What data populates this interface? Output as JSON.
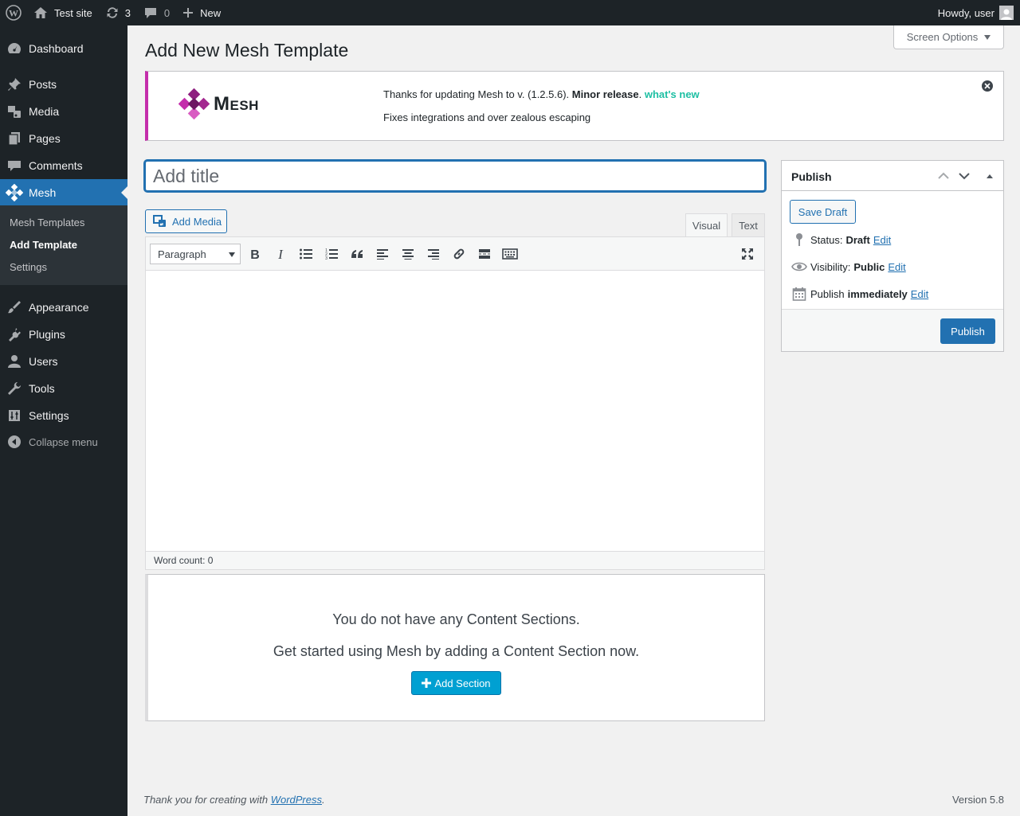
{
  "adminbar": {
    "site_name": "Test site",
    "updates_count": "3",
    "comments_count": "0",
    "new_label": "New",
    "howdy": "Howdy, user"
  },
  "sidebar": {
    "items": [
      {
        "label": "Dashboard",
        "icon": "dashboard-icon"
      },
      {
        "label": "Posts",
        "icon": "pin-icon"
      },
      {
        "label": "Media",
        "icon": "media-icon"
      },
      {
        "label": "Pages",
        "icon": "pages-icon"
      },
      {
        "label": "Comments",
        "icon": "comment-icon"
      },
      {
        "label": "Mesh",
        "icon": "mesh-icon"
      },
      {
        "label": "Appearance",
        "icon": "brush-icon"
      },
      {
        "label": "Plugins",
        "icon": "plugin-icon"
      },
      {
        "label": "Users",
        "icon": "user-icon"
      },
      {
        "label": "Tools",
        "icon": "wrench-icon"
      },
      {
        "label": "Settings",
        "icon": "settings-icon"
      }
    ],
    "submenu": [
      "Mesh Templates",
      "Add Template",
      "Settings"
    ],
    "collapse_label": "Collapse menu"
  },
  "page": {
    "title": "Add New Mesh Template",
    "screen_options": "Screen Options"
  },
  "notice": {
    "logo_text": "Mesh",
    "line1_prefix": "Thanks for updating Mesh to v. (1.2.5.6). ",
    "line1_bold": "Minor release",
    "line1_sep": ". ",
    "line1_link": "what's new",
    "line2": "Fixes integrations and over zealous escaping"
  },
  "editor": {
    "title_placeholder": "Add title",
    "add_media": "Add Media",
    "tab_visual": "Visual",
    "tab_text": "Text",
    "format_value": "Paragraph",
    "word_count": "Word count: 0"
  },
  "mesh": {
    "message1": "You do not have any Content Sections.",
    "message2": "Get started using Mesh by adding a Content Section now.",
    "add_section": "Add Section"
  },
  "publish": {
    "title": "Publish",
    "save_draft": "Save Draft",
    "status_label": "Status:",
    "status_value": "Draft",
    "visibility_label": "Visibility:",
    "visibility_value": "Public",
    "schedule_label": "Publish",
    "schedule_value": "immediately",
    "edit_label": "Edit",
    "publish_button": "Publish"
  },
  "footer": {
    "thanks_prefix": "Thank you for creating with ",
    "thanks_link": "WordPress",
    "thanks_suffix": ".",
    "version": "Version 5.8"
  },
  "colors": {
    "accent": "#2271b1",
    "mesh_brand": "#c42dab",
    "mesh_link": "#1dbfa3",
    "add_section": "#00a0d2",
    "admin_dark": "#1d2327"
  }
}
